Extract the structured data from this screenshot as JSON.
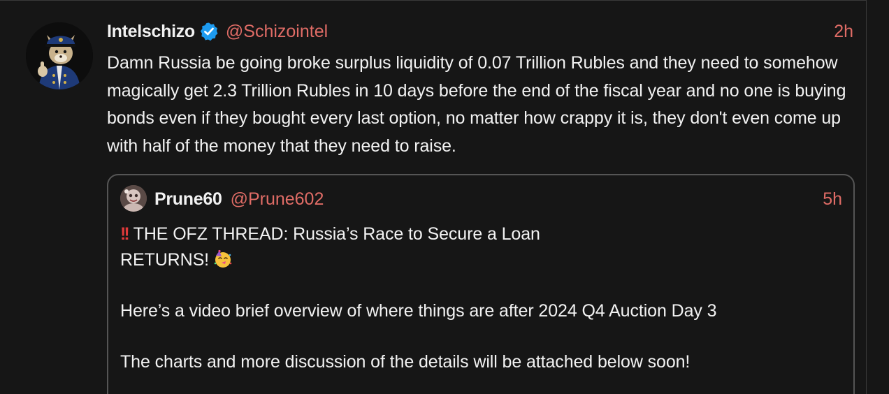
{
  "post": {
    "author_name": "Intelschizo",
    "handle": "@Schizointel",
    "time": "2h",
    "avatar": "police-cat-avatar",
    "verified_icon": "verified-badge-icon",
    "text": "Damn Russia be going broke surplus liquidity of 0.07 Trillion Rubles and they need to somehow magically get 2.3 Trillion Rubles in 10 days before the end of the fiscal year and no one is buying bonds even if they bought every last option, no matter how crappy it is, they don't even come up with half of the money that they need to raise."
  },
  "quote": {
    "author_name": "Prune60",
    "handle": "@Prune602",
    "time": "5h",
    "avatar": "profile-avatar",
    "line1_icon": "double-exclamation-icon",
    "line1_text": "THE OFZ THREAD: Russia’s Race to Secure a Loan",
    "line2_text": "RETURNS!",
    "line2_icon": "party-face-emoji",
    "line3_text": "Here’s a video brief overview of where things are after 2024 Q4 Auction Day 3",
    "line4_text": "The charts and more discussion of the details will be attached below soon!"
  },
  "colors": {
    "background": "#161616",
    "text": "#f2f2f2",
    "handle": "#e06c66",
    "verified": "#1d9bf0",
    "border": "#555555"
  }
}
